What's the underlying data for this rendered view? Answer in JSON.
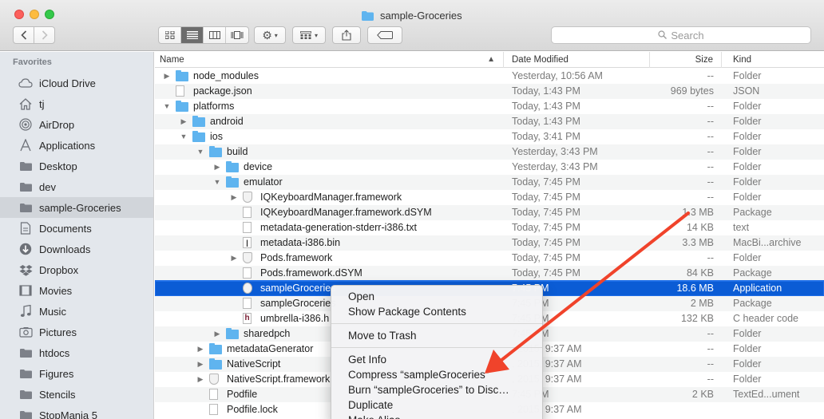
{
  "window": {
    "title": "sample-Groceries"
  },
  "toolbar": {
    "search_placeholder": "Search"
  },
  "sidebar": {
    "header": "Favorites",
    "items": [
      {
        "label": "iCloud Drive",
        "icon": "cloud-icon"
      },
      {
        "label": "tj",
        "icon": "home-icon"
      },
      {
        "label": "AirDrop",
        "icon": "airdrop-icon"
      },
      {
        "label": "Applications",
        "icon": "applications-icon"
      },
      {
        "label": "Desktop",
        "icon": "folder-icon"
      },
      {
        "label": "dev",
        "icon": "folder-icon"
      },
      {
        "label": "sample-Groceries",
        "icon": "folder-icon",
        "selected": true
      },
      {
        "label": "Documents",
        "icon": "documents-icon"
      },
      {
        "label": "Downloads",
        "icon": "downloads-icon"
      },
      {
        "label": "Dropbox",
        "icon": "dropbox-icon"
      },
      {
        "label": "Movies",
        "icon": "movies-icon"
      },
      {
        "label": "Music",
        "icon": "music-icon"
      },
      {
        "label": "Pictures",
        "icon": "pictures-icon"
      },
      {
        "label": "htdocs",
        "icon": "folder-icon"
      },
      {
        "label": "Figures",
        "icon": "folder-icon"
      },
      {
        "label": "Stencils",
        "icon": "folder-icon"
      },
      {
        "label": "StopMania 5",
        "icon": "folder-icon"
      }
    ]
  },
  "columns": {
    "name": "Name",
    "date": "Date Modified",
    "size": "Size",
    "kind": "Kind"
  },
  "files": [
    {
      "name": "node_modules",
      "date": "Yesterday, 10:56 AM",
      "size": "--",
      "kind": "Folder",
      "level": 0,
      "disc": "closed",
      "icon": "folder"
    },
    {
      "name": "package.json",
      "date": "Today, 1:43 PM",
      "size": "969 bytes",
      "kind": "JSON",
      "level": 0,
      "disc": "none",
      "icon": "doc"
    },
    {
      "name": "platforms",
      "date": "Today, 1:43 PM",
      "size": "--",
      "kind": "Folder",
      "level": 0,
      "disc": "open",
      "icon": "folder"
    },
    {
      "name": "android",
      "date": "Today, 1:43 PM",
      "size": "--",
      "kind": "Folder",
      "level": 1,
      "disc": "closed",
      "icon": "folder"
    },
    {
      "name": "ios",
      "date": "Today, 3:41 PM",
      "size": "--",
      "kind": "Folder",
      "level": 1,
      "disc": "open",
      "icon": "folder"
    },
    {
      "name": "build",
      "date": "Yesterday, 3:43 PM",
      "size": "--",
      "kind": "Folder",
      "level": 2,
      "disc": "open",
      "icon": "folder"
    },
    {
      "name": "device",
      "date": "Yesterday, 3:43 PM",
      "size": "--",
      "kind": "Folder",
      "level": 3,
      "disc": "closed",
      "icon": "folder"
    },
    {
      "name": "emulator",
      "date": "Today, 7:45 PM",
      "size": "--",
      "kind": "Folder",
      "level": 3,
      "disc": "open",
      "icon": "folder"
    },
    {
      "name": "IQKeyboardManager.framework",
      "date": "Today, 7:45 PM",
      "size": "--",
      "kind": "Folder",
      "level": 4,
      "disc": "closed",
      "icon": "pkg"
    },
    {
      "name": "IQKeyboardManager.framework.dSYM",
      "date": "Today, 7:45 PM",
      "size": "1.3 MB",
      "kind": "Package",
      "level": 4,
      "disc": "none",
      "icon": "doc"
    },
    {
      "name": "metadata-generation-stderr-i386.txt",
      "date": "Today, 7:45 PM",
      "size": "14 KB",
      "kind": "text",
      "level": 4,
      "disc": "none",
      "icon": "doc"
    },
    {
      "name": "metadata-i386.bin",
      "date": "Today, 7:45 PM",
      "size": "3.3 MB",
      "kind": "MacBi...archive",
      "level": 4,
      "disc": "none",
      "icon": "bin"
    },
    {
      "name": "Pods.framework",
      "date": "Today, 7:45 PM",
      "size": "--",
      "kind": "Folder",
      "level": 4,
      "disc": "closed",
      "icon": "pkg"
    },
    {
      "name": "Pods.framework.dSYM",
      "date": "Today, 7:45 PM",
      "size": "84 KB",
      "kind": "Package",
      "level": 4,
      "disc": "none",
      "icon": "doc"
    },
    {
      "name": "sampleGroceries",
      "date": "7:45 PM",
      "size": "18.6 MB",
      "kind": "Application",
      "level": 4,
      "disc": "none",
      "icon": "app",
      "selected": true
    },
    {
      "name": "sampleGroceries",
      "date": "7:45 PM",
      "size": "2 MB",
      "kind": "Package",
      "level": 4,
      "disc": "none",
      "icon": "doc"
    },
    {
      "name": "umbrella-i386.h",
      "date": "7:45 PM",
      "size": "132 KB",
      "kind": "C header code",
      "level": 4,
      "disc": "none",
      "icon": "h"
    },
    {
      "name": "sharedpch",
      "date": "7:45 PM",
      "size": "--",
      "kind": "Folder",
      "level": 3,
      "disc": "closed",
      "icon": "folder"
    },
    {
      "name": "metadataGenerator",
      "date": ", 2015, 9:37 AM",
      "size": "--",
      "kind": "Folder",
      "level": 2,
      "disc": "closed",
      "icon": "folder"
    },
    {
      "name": "NativeScript",
      "date": ", 2015, 9:37 AM",
      "size": "--",
      "kind": "Folder",
      "level": 2,
      "disc": "closed",
      "icon": "folder"
    },
    {
      "name": "NativeScript.framework",
      "date": ", 2015, 9:37 AM",
      "size": "--",
      "kind": "Folder",
      "level": 2,
      "disc": "closed",
      "icon": "pkg"
    },
    {
      "name": "Podfile",
      "date": "7:45 PM",
      "size": "2 KB",
      "kind": "TextEd...ument",
      "level": 2,
      "disc": "none",
      "icon": "doc"
    },
    {
      "name": "Podfile.lock",
      "date": ", 2015, 9:37 AM",
      "size": "",
      "kind": "",
      "level": 2,
      "disc": "none",
      "icon": "doc"
    }
  ],
  "context_menu": {
    "groups": [
      [
        "Open",
        "Show Package Contents"
      ],
      [
        "Move to Trash"
      ],
      [
        "Get Info",
        "Compress “sampleGroceries”",
        "Burn “sampleGroceries” to Disc…",
        "Duplicate",
        "Make Alias"
      ]
    ]
  },
  "colors": {
    "selection": "#0b5cd5",
    "folder": "#5fb4ef",
    "annotation_arrow": "#f0432b"
  }
}
